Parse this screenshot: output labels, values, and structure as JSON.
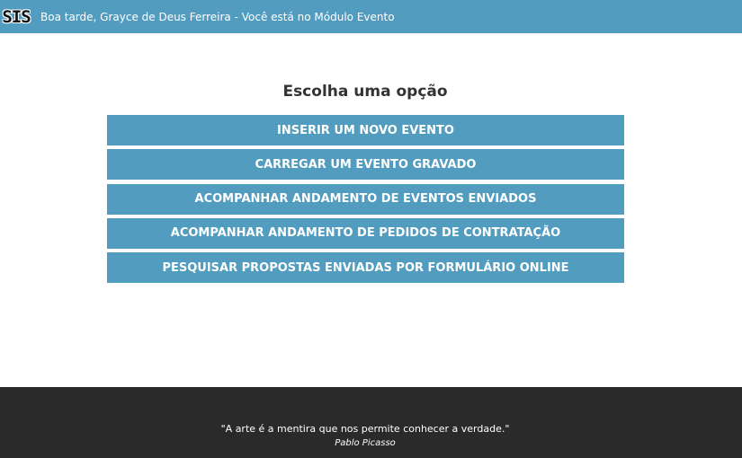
{
  "header": {
    "logo_text": "SIS",
    "greeting": "Boa tarde, Grayce de Deus Ferreira - Você está no Módulo Evento",
    "background_color": "#529cbf"
  },
  "main": {
    "title": "Escolha uma opção",
    "options": [
      {
        "label": "INSERIR UM NOVO EVENTO"
      },
      {
        "label": "CARREGAR UM EVENTO GRAVADO"
      },
      {
        "label": "ACOMPANHAR ANDAMENTO DE EVENTOS ENVIADOS"
      },
      {
        "label": "ACOMPANHAR ANDAMENTO DE PEDIDOS DE CONTRATAÇÃO"
      },
      {
        "label": "PESQUISAR PROPOSTAS ENVIADAS POR FORMULÁRIO ONLINE"
      }
    ],
    "button_color": "#529cbf"
  },
  "footer": {
    "quote": "\"A arte é a mentira que nos permite conhecer a verdade.\"",
    "author": "Pablo Picasso",
    "background_color": "#2a2a2a"
  }
}
